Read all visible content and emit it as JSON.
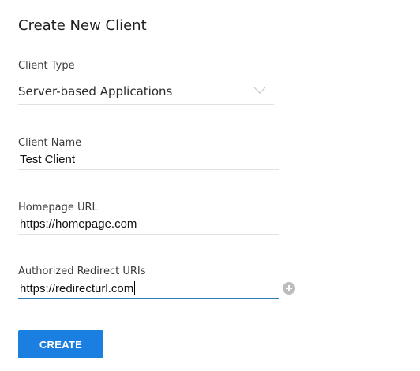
{
  "form": {
    "title": "Create New Client",
    "client_type": {
      "label": "Client Type",
      "value": "Server-based Applications"
    },
    "client_name": {
      "label": "Client Name",
      "value": "Test Client"
    },
    "homepage_url": {
      "label": "Homepage URL",
      "value": "https://homepage.com"
    },
    "redirect_uris": {
      "label": "Authorized Redirect URIs",
      "value": "https://redirecturl.com"
    },
    "create_label": "CREATE"
  },
  "icons": {
    "select_chevron": "chevron-down-icon",
    "add_uri": "plus-circle-icon"
  },
  "colors": {
    "primary_button": "#1a7fe0",
    "active_underline": "#2c7fb8",
    "add_icon_bg": "#bdbdbd"
  }
}
